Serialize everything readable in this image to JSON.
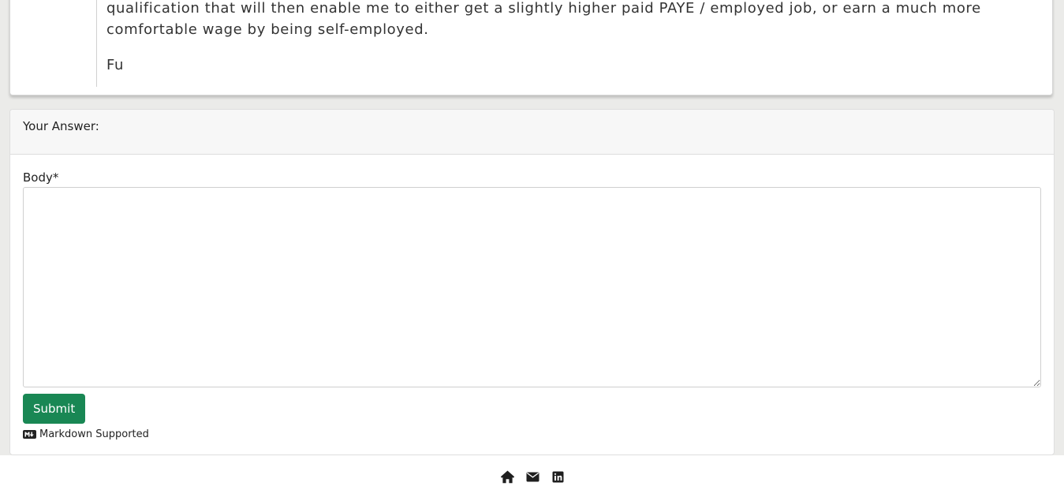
{
  "question": {
    "body_paragraph": "qualification that will then enable me to either get a slightly higher paid PAYE / employed job, or earn a much more comfortable wage by being self-employed.",
    "body_tail": "Fu"
  },
  "answer_form": {
    "header": "Your Answer:",
    "body_label": "Body*",
    "body_value": "",
    "submit_label": "Submit",
    "markdown_note": "Markdown Supported"
  },
  "footer": {
    "icons": [
      "home-icon",
      "envelope-icon",
      "linkedin-icon"
    ]
  },
  "colors": {
    "accent_green": "#198754",
    "page_background": "#ebebe9"
  }
}
